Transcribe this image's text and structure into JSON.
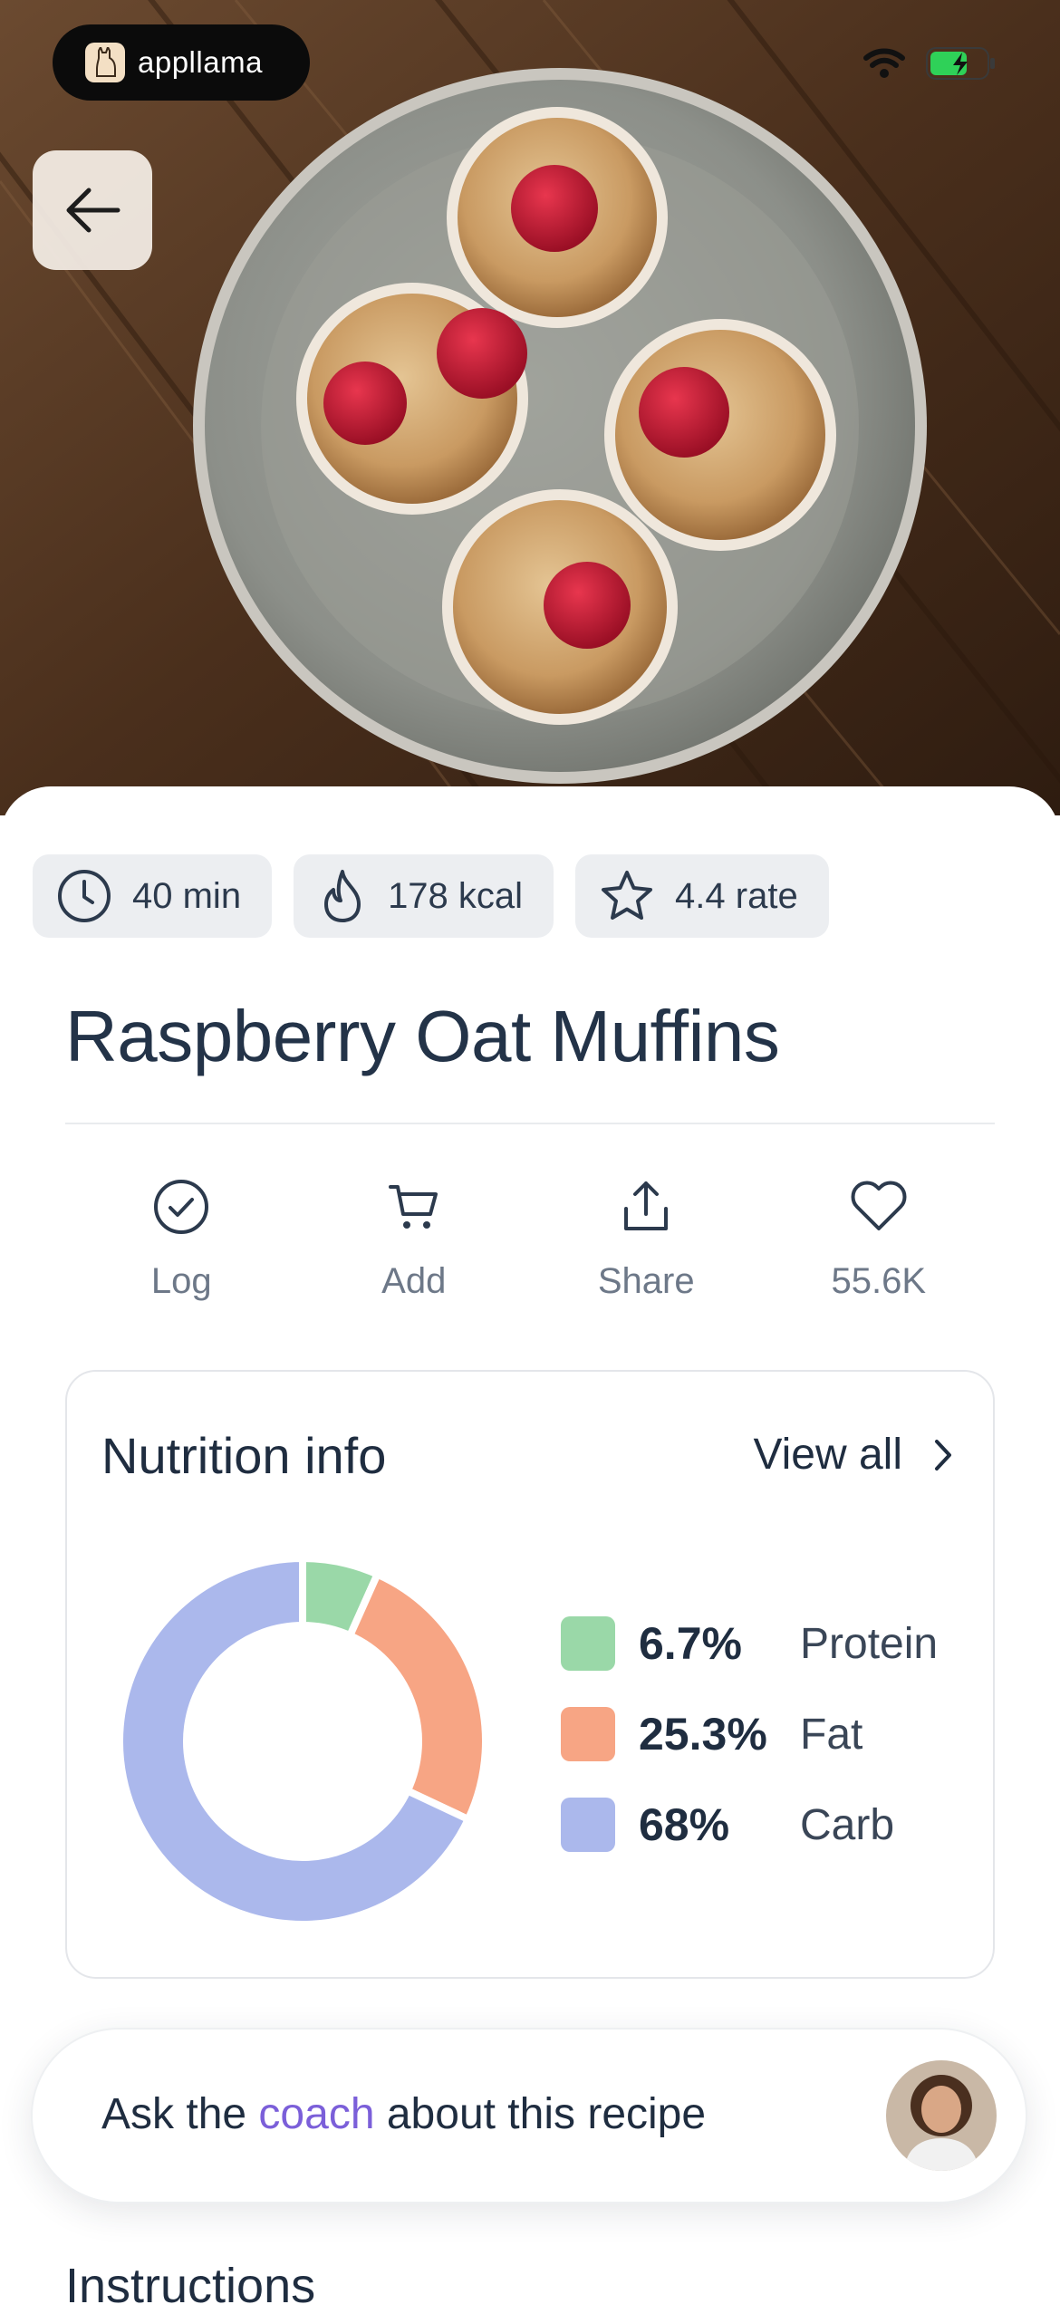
{
  "brand": {
    "name": "appllama",
    "logo_icon": "llama-icon"
  },
  "status_bar": {
    "wifi_icon": "wifi-icon",
    "battery_icon": "battery-charging-icon",
    "battery_color": "#2fd158"
  },
  "navigation": {
    "back_icon": "arrow-left-icon"
  },
  "hero": {
    "image_subject": "raspberry-oat-muffins-photo"
  },
  "chips": [
    {
      "icon": "clock-icon",
      "label": "40 min"
    },
    {
      "icon": "flame-icon",
      "label": "178 kcal"
    },
    {
      "icon": "star-icon",
      "label": "4.4 rate"
    }
  ],
  "recipe": {
    "title": "Raspberry Oat Muffins"
  },
  "actions": [
    {
      "icon": "check-circle-icon",
      "label": "Log"
    },
    {
      "icon": "cart-icon",
      "label": "Add"
    },
    {
      "icon": "share-icon",
      "label": "Share"
    },
    {
      "icon": "heart-icon",
      "label": "55.6K"
    }
  ],
  "nutrition": {
    "title": "Nutrition info",
    "view_all": "View all",
    "macros": [
      {
        "percent": "6.7%",
        "label": "Protein",
        "value": 6.7,
        "color": "#9ad8a8"
      },
      {
        "percent": "25.3%",
        "label": "Fat",
        "value": 25.3,
        "color": "#f7a584"
      },
      {
        "percent": "68%",
        "label": "Carb",
        "value": 68,
        "color": "#abb8ec"
      }
    ]
  },
  "coach": {
    "prefix": "Ask the ",
    "highlight": "coach",
    "suffix": " about this recipe",
    "accent_color": "#7b5fd9"
  },
  "instructions": {
    "heading": "Instructions"
  }
}
